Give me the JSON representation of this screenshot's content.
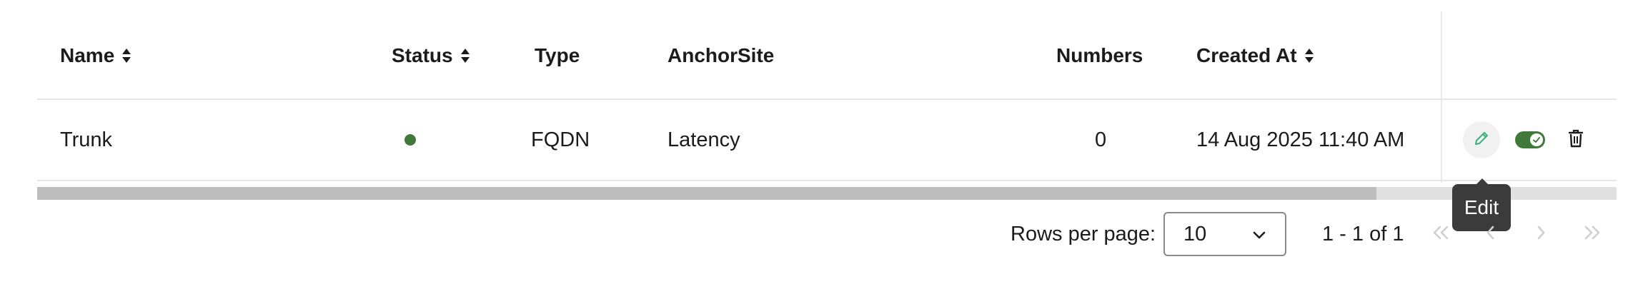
{
  "table": {
    "columns": [
      {
        "label": "Name",
        "sortable": true
      },
      {
        "label": "Status",
        "sortable": true
      },
      {
        "label": "Type",
        "sortable": false
      },
      {
        "label": "AnchorSite",
        "sortable": false
      },
      {
        "label": "Numbers",
        "sortable": false
      },
      {
        "label": "Created At",
        "sortable": true
      }
    ],
    "rows": [
      {
        "name": "Trunk",
        "status": "active",
        "type": "FQDN",
        "anchor_site": "Latency",
        "numbers": "0",
        "created_at": "14 Aug 2025 11:40 AM",
        "enabled": true
      }
    ]
  },
  "actions": {
    "edit_icon": "pencil-icon",
    "toggle_icon": "toggle-on-icon",
    "delete_icon": "trash-icon"
  },
  "tooltip": {
    "text": "Edit"
  },
  "pagination": {
    "rows_per_page_label": "Rows per page:",
    "rows_per_page_value": "10",
    "range_text": "1 - 1 of 1"
  },
  "colors": {
    "status_active": "#3f7a3a",
    "edit_icon": "#3cb07a",
    "tooltip_bg": "#3b3b3b"
  }
}
